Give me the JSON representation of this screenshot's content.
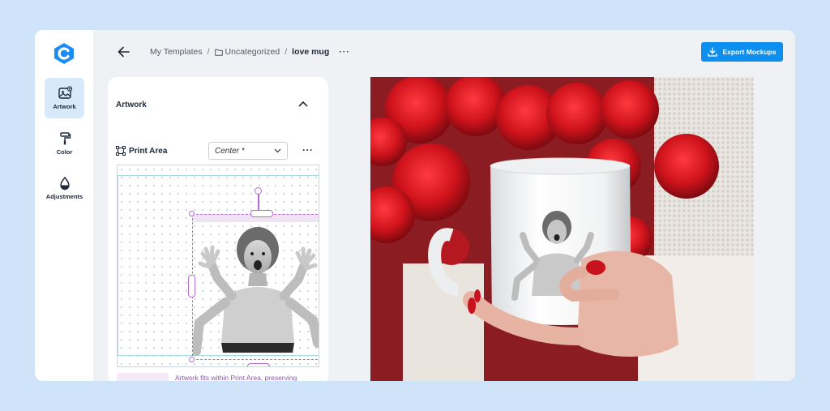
{
  "app": {
    "logo_icon": "app-logo-icon",
    "accent": "#0d8ff0"
  },
  "rail": {
    "items": [
      {
        "label": "Artwork",
        "icon": "artwork-image-icon",
        "active": true
      },
      {
        "label": "Color",
        "icon": "paint-roller-icon",
        "active": false
      },
      {
        "label": "Adjustments",
        "icon": "droplet-icon",
        "active": false
      }
    ]
  },
  "header": {
    "breadcrumb": {
      "root": "My Templates",
      "folder": "Uncategorized",
      "current": "love mug",
      "separator": "/"
    },
    "more_label": "···",
    "export_label": "Export Mockups"
  },
  "panel": {
    "section_title": "Artwork",
    "print_area_label": "Print Area",
    "position_select": "Center *",
    "more_label": "···",
    "hint": "Artwork fits within Print Area, preserving"
  },
  "colors": {
    "selection": "#b46bd6",
    "guide": "#a6dbe3",
    "rose": "#c8121d"
  }
}
